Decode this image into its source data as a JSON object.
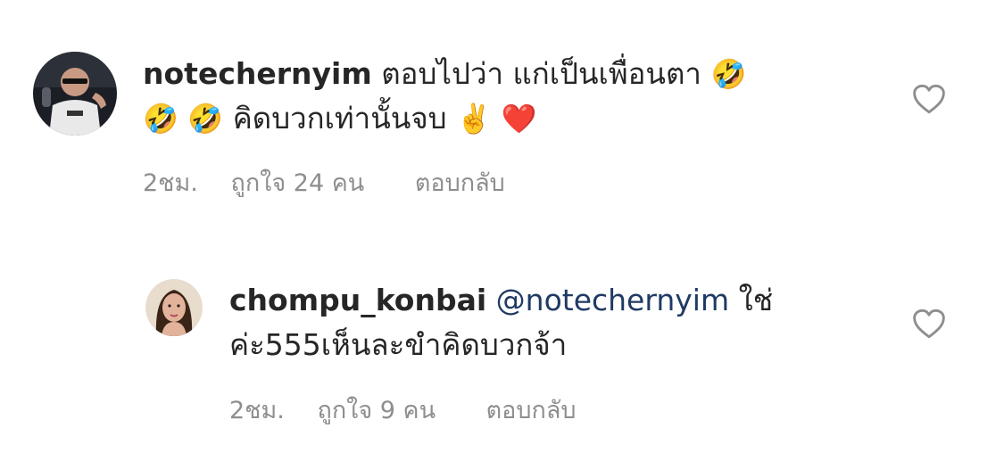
{
  "comments": [
    {
      "username": "notechernyim",
      "text_line1": "ตอบไปว่า แก่เป็นเพื่อนตา",
      "emoji1": "🤣",
      "emoji2": "🤣",
      "emoji3": "🤣",
      "text_line2": "คิดบวกเท่านั้นจบ",
      "emoji4": "✌️",
      "emoji5": "❤️",
      "time": "2ชม.",
      "likes": "ถูกใจ 24 คน",
      "reply_label": "ตอบกลับ",
      "avatar_icon": "avatar-man-sunglasses"
    },
    {
      "username": "chompu_konbai",
      "mention": "@notechernyim",
      "text_line1_suffix": "ใช่",
      "text_line2": "ค่ะ555เห็นละขำคิดบวกจ้า",
      "time": "2ชม.",
      "likes": "ถูกใจ 9 คน",
      "reply_label": "ตอบกลับ",
      "avatar_icon": "avatar-woman"
    }
  ],
  "colors": {
    "text": "#262626",
    "meta": "#8e8e8e",
    "mention": "#1f3a64",
    "heart_outline": "#8e8e8e"
  }
}
